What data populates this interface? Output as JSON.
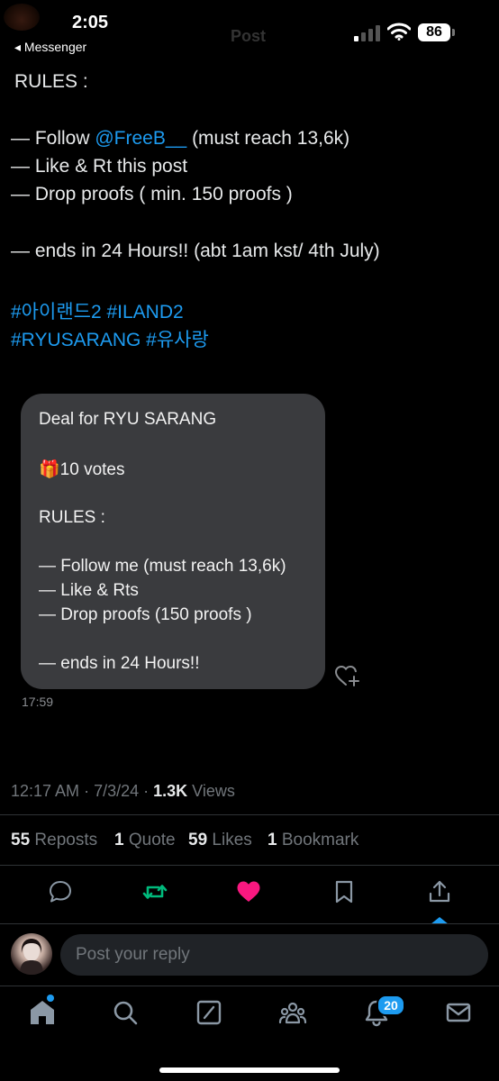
{
  "status_bar": {
    "time": "2:05",
    "back_app": "◂ Messenger",
    "header_title": "Post",
    "battery": "86"
  },
  "tweet": {
    "lines": [
      {
        "text": "RULES :"
      },
      {
        "prefix": "— Follow ",
        "mention": "@FreeB__",
        "suffix": " (must reach 13,6k)"
      },
      {
        "text": "— Like & Rt this post"
      },
      {
        "text": "— Drop proofs ( min. 150 proofs )"
      },
      {
        "text": "— ends in 24 Hours!! (abt 1am kst/ 4th July)"
      }
    ],
    "hashtags_line1": [
      "#아이랜드2",
      "#ILAND2"
    ],
    "hashtags_line2": [
      "#RYUSARANG",
      "#유사랑"
    ]
  },
  "chat_bubble": {
    "lines": [
      "Deal for RYU SARANG",
      "🎁10 votes",
      " RULES :",
      "— Follow me (must reach 13,6k)",
      "— Like & Rts",
      "— Drop proofs (150 proofs )",
      "— ends in 24 Hours!!"
    ],
    "time": "17:59"
  },
  "meta": {
    "time": "12:17 AM",
    "date": "7/3/24",
    "views_count": "1.3K",
    "views_label": "Views"
  },
  "stats": {
    "reposts_count": "55",
    "reposts_label": "Reposts",
    "quotes_count": "1",
    "quotes_label": "Quote",
    "likes_count": "59",
    "likes_label": "Likes",
    "bookmarks_count": "1",
    "bookmarks_label": "Bookmark"
  },
  "reply": {
    "placeholder": "Post your reply"
  },
  "nav": {
    "notifications_badge": "20"
  },
  "colors": {
    "accent": "#1d9bf0",
    "repost_green": "#00ba7c",
    "like_pink": "#f91880",
    "bubble": "#3a3b3e"
  }
}
